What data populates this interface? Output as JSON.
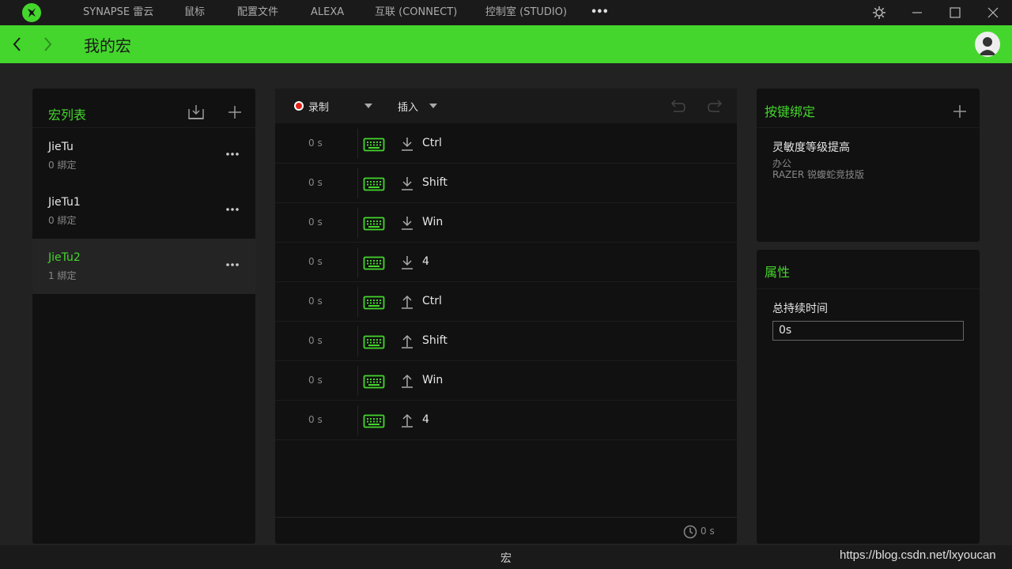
{
  "nav": {
    "items": [
      "SYNAPSE 雷云",
      "鼠标",
      "配置文件",
      "ALEXA",
      "互联 (CONNECT)",
      "控制室 (STUDIO)"
    ],
    "more": "•••"
  },
  "header": {
    "title": "我的宏"
  },
  "macro_list": {
    "title": "宏列表",
    "items": [
      {
        "name": "JieTu",
        "bindings": "0 綁定"
      },
      {
        "name": "JieTu1",
        "bindings": "0 綁定"
      },
      {
        "name": "JieTu2",
        "bindings": "1 綁定"
      }
    ],
    "selected_index": 2
  },
  "editor": {
    "record_label": "录制",
    "insert_label": "插入",
    "rows": [
      {
        "time": "0 s",
        "direction": "down",
        "key": "Ctrl"
      },
      {
        "time": "0 s",
        "direction": "down",
        "key": "Shift"
      },
      {
        "time": "0 s",
        "direction": "down",
        "key": "Win"
      },
      {
        "time": "0 s",
        "direction": "down",
        "key": "4"
      },
      {
        "time": "0 s",
        "direction": "up",
        "key": "Ctrl"
      },
      {
        "time": "0 s",
        "direction": "up",
        "key": "Shift"
      },
      {
        "time": "0 s",
        "direction": "up",
        "key": "Win"
      },
      {
        "time": "0 s",
        "direction": "up",
        "key": "4"
      }
    ],
    "total_time": "0 s"
  },
  "key_binding": {
    "title": "按键绑定",
    "entry": {
      "name": "灵敏度等级提高",
      "profile": "办公",
      "device": "RAZER 锐蝮蛇竞技版"
    }
  },
  "properties": {
    "title": "属性",
    "duration_label": "总持续时间",
    "duration_value": "0s"
  },
  "status": {
    "label": "宏"
  },
  "watermark": "https://blog.csdn.net/lxyoucan",
  "colors": {
    "accent": "#44d62c",
    "record": "#e2231a",
    "panel": "#111111",
    "background": "#222222"
  }
}
